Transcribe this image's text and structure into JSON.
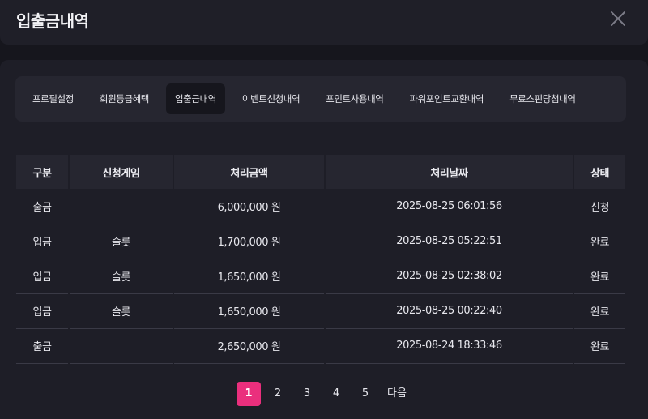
{
  "header": {
    "title": "입출금내역"
  },
  "icons": {
    "close": "close-icon"
  },
  "colors": {
    "accent": "#ea2f7d",
    "background": "#16161d",
    "panel": "#1e1e27",
    "surface": "#262630"
  },
  "tabs": [
    {
      "label": "프로필설정",
      "active": false
    },
    {
      "label": "회원등급혜택",
      "active": false
    },
    {
      "label": "입출금내역",
      "active": true
    },
    {
      "label": "이벤트신청내역",
      "active": false
    },
    {
      "label": "포인트사용내역",
      "active": false
    },
    {
      "label": "파워포인트교환내역",
      "active": false
    },
    {
      "label": "무료스핀당첨내역",
      "active": false
    }
  ],
  "table": {
    "columns": [
      "구분",
      "신청게임",
      "처리금액",
      "처리날짜",
      "상태"
    ],
    "rows": [
      {
        "type": "출금",
        "game": "",
        "amount": "6,000,000 원",
        "date": "2025-08-25 06:01:56",
        "status": "신청"
      },
      {
        "type": "입금",
        "game": "슬롯",
        "amount": "1,700,000 원",
        "date": "2025-08-25 05:22:51",
        "status": "완료"
      },
      {
        "type": "입금",
        "game": "슬롯",
        "amount": "1,650,000 원",
        "date": "2025-08-25 02:38:02",
        "status": "완료"
      },
      {
        "type": "입금",
        "game": "슬롯",
        "amount": "1,650,000 원",
        "date": "2025-08-25 00:22:40",
        "status": "완료"
      },
      {
        "type": "출금",
        "game": "",
        "amount": "2,650,000 원",
        "date": "2025-08-24 18:33:46",
        "status": "완료"
      }
    ]
  },
  "pagination": {
    "pages": [
      "1",
      "2",
      "3",
      "4",
      "5"
    ],
    "current": "1",
    "next_label": "다음"
  }
}
